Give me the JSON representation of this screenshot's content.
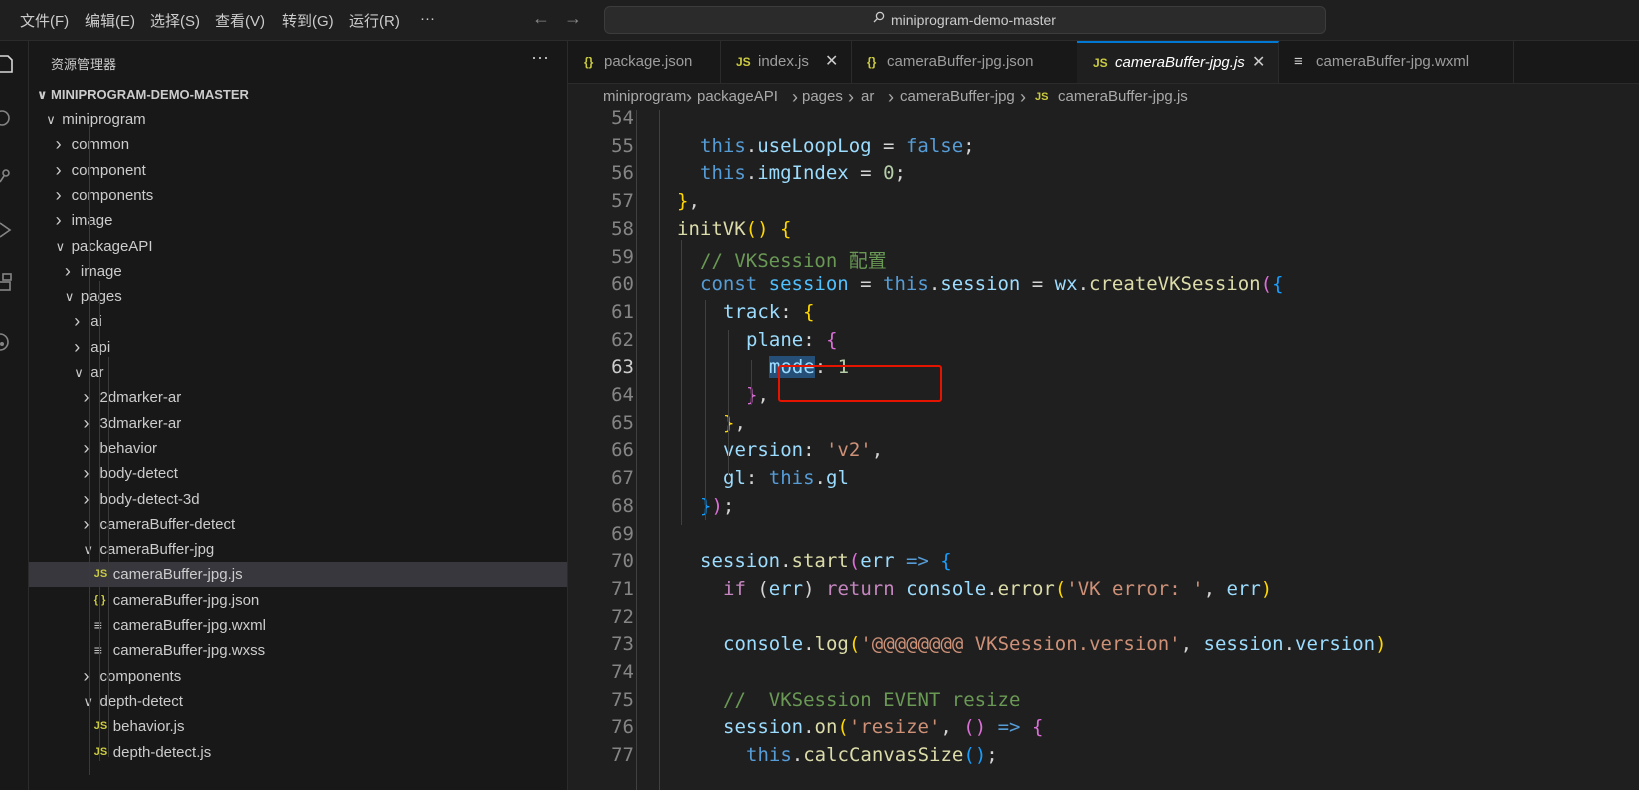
{
  "menubar": {
    "items": [
      "文件(F)",
      "编辑(E)",
      "选择(S)",
      "查看(V)",
      "转到(G)",
      "运行(R)",
      "···"
    ],
    "search": "miniprogram-demo-master"
  },
  "sidebar": {
    "title": "资源管理器",
    "more": "···",
    "root": "MINIPROGRAM-DEMO-MASTER",
    "tree": [
      {
        "label": "miniprogram",
        "type": "folder",
        "expanded": true
      },
      {
        "label": "common",
        "type": "folder",
        "expanded": false
      },
      {
        "label": "component",
        "type": "folder",
        "expanded": false
      },
      {
        "label": "components",
        "type": "folder",
        "expanded": false
      },
      {
        "label": "image",
        "type": "folder",
        "expanded": false
      },
      {
        "label": "packageAPI",
        "type": "folder",
        "expanded": true
      },
      {
        "label": "image",
        "type": "folder",
        "expanded": false
      },
      {
        "label": "pages",
        "type": "folder",
        "expanded": true
      },
      {
        "label": "ai",
        "type": "folder",
        "expanded": false
      },
      {
        "label": "api",
        "type": "folder",
        "expanded": false
      },
      {
        "label": "ar",
        "type": "folder",
        "expanded": true
      },
      {
        "label": "2dmarker-ar",
        "type": "folder",
        "expanded": false
      },
      {
        "label": "3dmarker-ar",
        "type": "folder",
        "expanded": false
      },
      {
        "label": "behavior",
        "type": "folder",
        "expanded": false
      },
      {
        "label": "body-detect",
        "type": "folder",
        "expanded": false
      },
      {
        "label": "body-detect-3d",
        "type": "folder",
        "expanded": false
      },
      {
        "label": "cameraBuffer-detect",
        "type": "folder",
        "expanded": false
      },
      {
        "label": "cameraBuffer-jpg",
        "type": "folder",
        "expanded": true
      },
      {
        "label": "cameraBuffer-jpg.js",
        "type": "js",
        "selected": true
      },
      {
        "label": "cameraBuffer-jpg.json",
        "type": "json"
      },
      {
        "label": "cameraBuffer-jpg.wxml",
        "type": "doc"
      },
      {
        "label": "cameraBuffer-jpg.wxss",
        "type": "doc"
      },
      {
        "label": "components",
        "type": "folder",
        "expanded": false
      },
      {
        "label": "depth-detect",
        "type": "folder",
        "expanded": true
      },
      {
        "label": "behavior.js",
        "type": "js"
      },
      {
        "label": "depth-detect.js",
        "type": "js"
      }
    ]
  },
  "tabs": [
    {
      "label": "package.json",
      "icon": "{}",
      "active": false
    },
    {
      "label": "index.js",
      "icon": "JS",
      "active": false,
      "close": "✕"
    },
    {
      "label": "cameraBuffer-jpg.json",
      "icon": "{}",
      "active": false
    },
    {
      "label": "cameraBuffer-jpg.js",
      "icon": "JS",
      "active": true,
      "close": "✕"
    },
    {
      "label": "cameraBuffer-jpg.wxml",
      "icon": "≡",
      "active": false
    }
  ],
  "breadcrumb": [
    "miniprogram",
    "packageAPI",
    "pages",
    "ar",
    "cameraBuffer-jpg",
    "cameraBuffer-jpg.js"
  ],
  "editor": {
    "current_line": 63,
    "lines": [
      {
        "n": "54",
        "indent": 2,
        "tokens": []
      },
      {
        "n": "55",
        "indent": 3,
        "tokens": [
          [
            "this",
            "k-this"
          ],
          [
            ".",
            ""
          ],
          [
            "useLoopLog",
            "k-prop"
          ],
          [
            " = ",
            ""
          ],
          [
            "false",
            "k-kw"
          ],
          [
            ";",
            ""
          ]
        ]
      },
      {
        "n": "56",
        "indent": 3,
        "tokens": [
          [
            "this",
            "k-this"
          ],
          [
            ".",
            ""
          ],
          [
            "imgIndex",
            "k-prop"
          ],
          [
            " = ",
            ""
          ],
          [
            "0",
            "k-num"
          ],
          [
            ";",
            ""
          ]
        ]
      },
      {
        "n": "57",
        "indent": 2,
        "tokens": [
          [
            "}",
            "k-b1"
          ],
          [
            ",",
            ""
          ]
        ]
      },
      {
        "n": "58",
        "indent": 2,
        "tokens": [
          [
            "initVK",
            "k-fn"
          ],
          [
            "() ",
            "k-b1"
          ],
          [
            "{",
            "k-b1"
          ]
        ]
      },
      {
        "n": "59",
        "indent": 3,
        "tokens": [
          [
            "// VKSession 配置",
            "k-cmt"
          ]
        ]
      },
      {
        "n": "60",
        "indent": 3,
        "tokens": [
          [
            "const ",
            "k-kw"
          ],
          [
            "session",
            "k-var"
          ],
          [
            " = ",
            ""
          ],
          [
            "this",
            "k-this"
          ],
          [
            ".",
            ""
          ],
          [
            "session",
            "k-prop"
          ],
          [
            " = ",
            ""
          ],
          [
            "wx",
            "k-prop"
          ],
          [
            ".",
            ""
          ],
          [
            "createVKSession",
            "k-fn"
          ],
          [
            "(",
            "k-b2"
          ],
          [
            "{",
            "k-b3"
          ]
        ]
      },
      {
        "n": "61",
        "indent": 4,
        "tokens": [
          [
            "track",
            "k-prop"
          ],
          [
            ": ",
            ""
          ],
          [
            "{",
            "k-b1"
          ]
        ]
      },
      {
        "n": "62",
        "indent": 5,
        "tokens": [
          [
            "plane",
            "k-prop"
          ],
          [
            ": ",
            ""
          ],
          [
            "{",
            "k-b2"
          ]
        ]
      },
      {
        "n": "63",
        "indent": 6,
        "tokens": [
          [
            "mode",
            "k-prop sel-word"
          ],
          [
            ": ",
            ""
          ],
          [
            "1",
            "k-num"
          ]
        ]
      },
      {
        "n": "64",
        "indent": 5,
        "tokens": [
          [
            "}",
            "k-b2"
          ],
          [
            ",",
            ""
          ]
        ]
      },
      {
        "n": "65",
        "indent": 4,
        "tokens": [
          [
            "}",
            "k-b1"
          ],
          [
            ",",
            ""
          ]
        ]
      },
      {
        "n": "66",
        "indent": 4,
        "tokens": [
          [
            "version",
            "k-prop"
          ],
          [
            ": ",
            ""
          ],
          [
            "'v2'",
            "k-str"
          ],
          [
            ",",
            ""
          ]
        ]
      },
      {
        "n": "67",
        "indent": 4,
        "tokens": [
          [
            "gl",
            "k-prop"
          ],
          [
            ": ",
            ""
          ],
          [
            "this",
            "k-this"
          ],
          [
            ".",
            ""
          ],
          [
            "gl",
            "k-prop"
          ]
        ]
      },
      {
        "n": "68",
        "indent": 3,
        "tokens": [
          [
            "}",
            "k-b3"
          ],
          [
            ")",
            "k-b2"
          ],
          [
            ";",
            ""
          ]
        ]
      },
      {
        "n": "69",
        "indent": 3,
        "tokens": []
      },
      {
        "n": "70",
        "indent": 3,
        "tokens": [
          [
            "session",
            "k-prop"
          ],
          [
            ".",
            ""
          ],
          [
            "start",
            "k-fn"
          ],
          [
            "(",
            "k-b2"
          ],
          [
            "err",
            "k-prop"
          ],
          [
            " => ",
            "k-kw"
          ],
          [
            "{",
            "k-b3"
          ]
        ]
      },
      {
        "n": "71",
        "indent": 4,
        "tokens": [
          [
            "if",
            "k-ctl"
          ],
          [
            " (",
            ""
          ],
          [
            "err",
            "k-prop"
          ],
          [
            ") ",
            ""
          ],
          [
            "return",
            "k-ctl"
          ],
          [
            " ",
            ""
          ],
          [
            "console",
            "k-prop"
          ],
          [
            ".",
            ""
          ],
          [
            "error",
            "k-fn"
          ],
          [
            "(",
            "k-b1"
          ],
          [
            "'VK error: '",
            "k-str"
          ],
          [
            ", ",
            ""
          ],
          [
            "err",
            "k-prop"
          ],
          [
            ")",
            "k-b1"
          ]
        ]
      },
      {
        "n": "72",
        "indent": 4,
        "tokens": []
      },
      {
        "n": "73",
        "indent": 4,
        "tokens": [
          [
            "console",
            "k-prop"
          ],
          [
            ".",
            ""
          ],
          [
            "log",
            "k-fn"
          ],
          [
            "(",
            "k-b1"
          ],
          [
            "'@@@@@@@@ VKSession.version'",
            "k-str"
          ],
          [
            ", ",
            ""
          ],
          [
            "session",
            "k-prop"
          ],
          [
            ".",
            ""
          ],
          [
            "version",
            "k-prop"
          ],
          [
            ")",
            "k-b1"
          ]
        ]
      },
      {
        "n": "74",
        "indent": 4,
        "tokens": []
      },
      {
        "n": "75",
        "indent": 4,
        "tokens": [
          [
            "//  VKSession EVENT resize",
            "k-cmt"
          ]
        ]
      },
      {
        "n": "76",
        "indent": 4,
        "tokens": [
          [
            "session",
            "k-prop"
          ],
          [
            ".",
            ""
          ],
          [
            "on",
            "k-fn"
          ],
          [
            "(",
            "k-b1"
          ],
          [
            "'resize'",
            "k-str"
          ],
          [
            ", ",
            ""
          ],
          [
            "()",
            "k-b2"
          ],
          [
            " => ",
            "k-kw"
          ],
          [
            "{",
            "k-b2"
          ]
        ]
      },
      {
        "n": "77",
        "indent": 5,
        "tokens": [
          [
            "this",
            "k-this"
          ],
          [
            ".",
            ""
          ],
          [
            "calcCanvasSize",
            "k-fn"
          ],
          [
            "()",
            "k-b3"
          ],
          [
            ";",
            ""
          ]
        ]
      }
    ]
  }
}
